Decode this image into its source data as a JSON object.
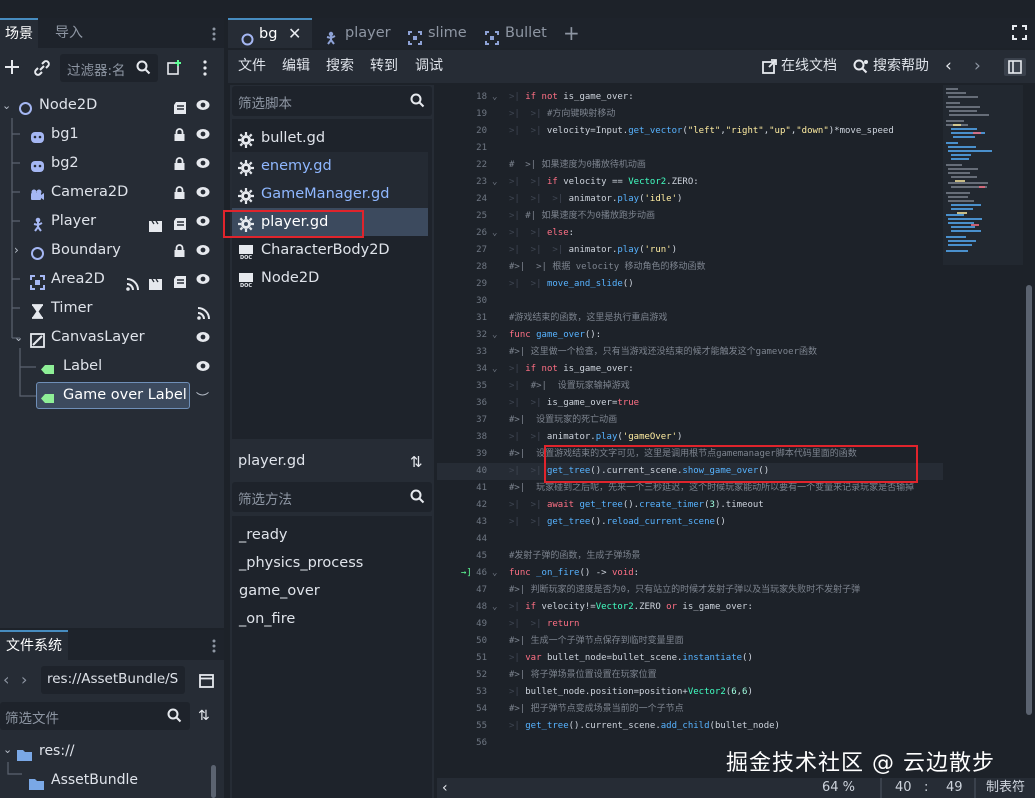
{
  "scene_dock": {
    "tabs": [
      "场景",
      "导入"
    ],
    "filter_placeholder": "过滤器:名",
    "tree": [
      {
        "name": "Node2D"
      },
      {
        "name": "bg1"
      },
      {
        "name": "bg2"
      },
      {
        "name": "Camera2D"
      },
      {
        "name": "Player"
      },
      {
        "name": "Boundary"
      },
      {
        "name": "Area2D"
      },
      {
        "name": "Timer"
      },
      {
        "name": "CanvasLayer"
      },
      {
        "name": "Label"
      },
      {
        "name": "Game over Label"
      }
    ]
  },
  "filesystem": {
    "title": "文件系统",
    "path": "res://AssetBundle/S",
    "filter_placeholder": "筛选文件",
    "items": [
      "res://",
      "AssetBundle"
    ]
  },
  "editor_tabs": [
    "bg",
    "player",
    "slime",
    "Bullet"
  ],
  "menu": {
    "items": [
      "文件",
      "编辑",
      "搜索",
      "转到",
      "调试"
    ],
    "online_docs": "在线文档",
    "search_help": "搜索帮助"
  },
  "scripts": {
    "filter_placeholder": "筛选脚本",
    "items": [
      "bullet.gd",
      "enemy.gd",
      "GameManager.gd",
      "player.gd",
      "CharacterBody2D",
      "Node2D"
    ],
    "current": "player.gd"
  },
  "methods": {
    "filter_placeholder": "筛选方法",
    "items": [
      "_ready",
      "_physics_process",
      "game_over",
      "_on_fire"
    ]
  },
  "code": {
    "line_numbers": [
      "18",
      "19",
      "20",
      "21",
      "22",
      "23",
      "24",
      "25",
      "26",
      "27",
      "28",
      "29",
      "30",
      "31",
      "32",
      "33",
      "34",
      "35",
      "36",
      "37",
      "38",
      "39",
      "40",
      "41",
      "42",
      "43",
      "44",
      "45",
      "46",
      "47",
      "48",
      "49",
      "50",
      "51",
      "52",
      "53",
      "54",
      "55",
      "56"
    ]
  },
  "status": {
    "zoom": "64 %",
    "line": "40",
    "col": "49",
    "indent": "制表符"
  },
  "watermark": "掘金技术社区 @ 云边散步",
  "colors": {
    "accent": "#478cbf",
    "highlight_box": "#e0242c",
    "keyword": "#ff7085",
    "function": "#57b3ff",
    "string": "#ffeda1",
    "comment": "#7d848f",
    "type": "#42ffc2"
  }
}
